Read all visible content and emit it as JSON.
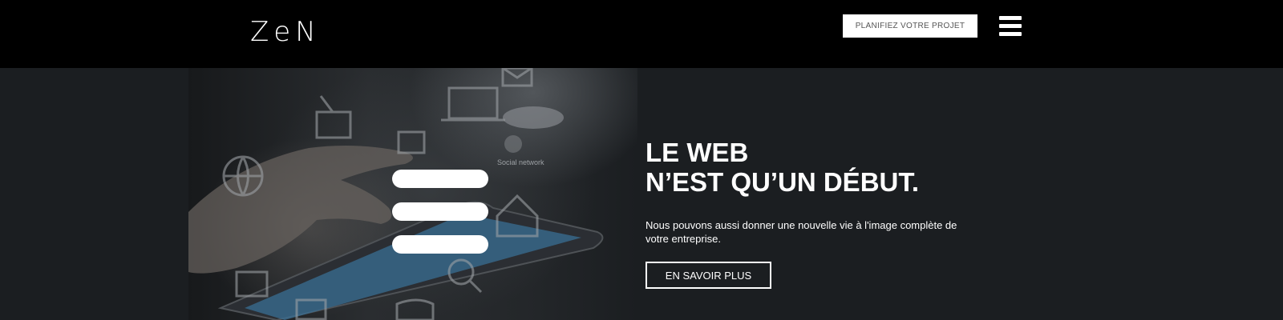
{
  "header": {
    "logo_text": "ZeN",
    "cta_label": "PLANIFIEZ VOTRE PROJET",
    "menu_icon": "hamburger-menu-icon"
  },
  "hero": {
    "image_caption": "Social network",
    "play_icon": "hamburger-menu-icon",
    "headline_line1": "LE WEB",
    "headline_line2": "N’EST QU’UN DÉBUT.",
    "description": "Nous pouvons aussi donner une nouvelle vie à l'image complète de votre entreprise.",
    "cta_label": "EN SAVOIR PLUS"
  },
  "colors": {
    "header_bg": "#000000",
    "hero_bg": "#1b1e21",
    "text": "#ffffff",
    "button_text": "#555555"
  }
}
